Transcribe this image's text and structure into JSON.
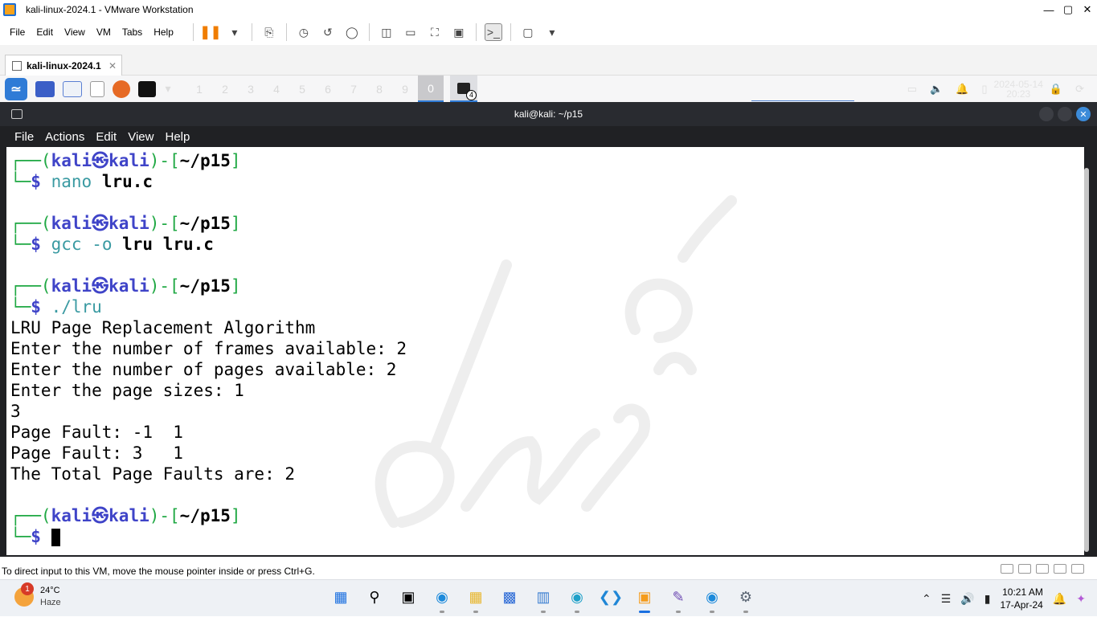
{
  "vmware": {
    "window_title": "kali-linux-2024.1 - VMware Workstation",
    "menu": [
      "File",
      "Edit",
      "View",
      "VM",
      "Tabs",
      "Help"
    ],
    "tab_label": "kali-linux-2024.1",
    "status_text": "To direct input to this VM, move the mouse pointer inside or press Ctrl+G."
  },
  "kali_panel": {
    "workspaces": [
      "1",
      "2",
      "3",
      "4",
      "5",
      "6",
      "7",
      "8",
      "9",
      "0"
    ],
    "active_workspace": "0",
    "terminal_count": "4",
    "date": "2024-05-14",
    "time": "20:23"
  },
  "terminal": {
    "title": "kali@kali: ~/p15",
    "menu": [
      "File",
      "Actions",
      "Edit",
      "View",
      "Help"
    ],
    "prompt": {
      "user": "kali",
      "host": "kali",
      "sep": "㉿",
      "path": "~/p15"
    },
    "commands": [
      {
        "cmd": "nano",
        "args": "lru.c"
      },
      {
        "cmd": "gcc",
        "flag": "-o",
        "args": "lru lru.c"
      },
      {
        "cmd": "./lru"
      }
    ],
    "output": [
      "LRU Page Replacement Algorithm",
      "Enter the number of frames available: 2",
      "Enter the number of pages available: 2",
      "Enter the page sizes: 1",
      "3",
      "Page Fault: -1  1",
      "Page Fault: 3   1",
      "The Total Page Faults are: 2"
    ],
    "watermark": "dny.one"
  },
  "windows_taskbar": {
    "temperature": "24°C",
    "weather": "Haze",
    "weather_badge": "1",
    "time": "10:21 AM",
    "date": "17-Apr-24"
  }
}
